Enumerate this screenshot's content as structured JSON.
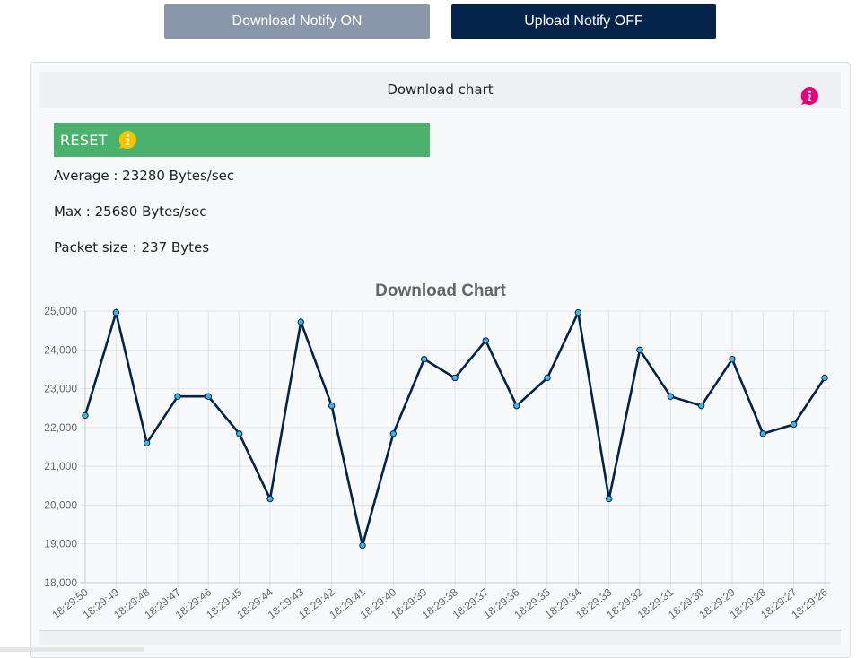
{
  "buttons": {
    "download_notify": "Download Notify ON",
    "upload_notify": "Upload Notify OFF"
  },
  "panel": {
    "title": "Download chart",
    "reset_label": "RESET",
    "info_icon": "info-icon",
    "stats": {
      "average": "Average : 23280 Bytes/sec",
      "max": "Max : 25680 Bytes/sec",
      "packet_size": "Packet size : 237 Bytes"
    }
  },
  "colors": {
    "download_button": "#8a97aa",
    "upload_button": "#03234b",
    "reset_bar": "#4bb26d",
    "info_pink": "#e6007e",
    "info_yellow": "#f5c400",
    "line": "#03234b",
    "point": "#3cb4e6"
  },
  "chart_data": {
    "type": "line",
    "title": "Download Chart",
    "xlabel": "",
    "ylabel": "",
    "ylim": [
      18000,
      25000
    ],
    "yticks": [
      18000,
      19000,
      20000,
      21000,
      22000,
      23000,
      24000,
      25000
    ],
    "ytick_labels": [
      "18,000",
      "19,000",
      "20,000",
      "21,000",
      "22,000",
      "23,000",
      "24,000",
      "25,000"
    ],
    "grid": true,
    "categories": [
      "18:29:50",
      "18:29:49",
      "18:29:48",
      "18:29:47",
      "18:29:46",
      "18:29:45",
      "18:29:44",
      "18:29:43",
      "18:29:42",
      "18:29:41",
      "18:29:40",
      "18:29:39",
      "18:29:38",
      "18:29:37",
      "18:29:36",
      "18:29:35",
      "18:29:34",
      "18:29:33",
      "18:29:32",
      "18:29:31",
      "18:29:30",
      "18:29:29",
      "18:29:28",
      "18:29:27",
      "18:29:26"
    ],
    "series": [
      {
        "name": "",
        "values": [
          22310,
          24960,
          21600,
          22800,
          22800,
          21840,
          20160,
          24720,
          22560,
          18960,
          21840,
          23760,
          23280,
          24240,
          22560,
          23280,
          24960,
          20160,
          24000,
          22800,
          22560,
          23760,
          21840,
          22080,
          23280
        ]
      }
    ]
  }
}
